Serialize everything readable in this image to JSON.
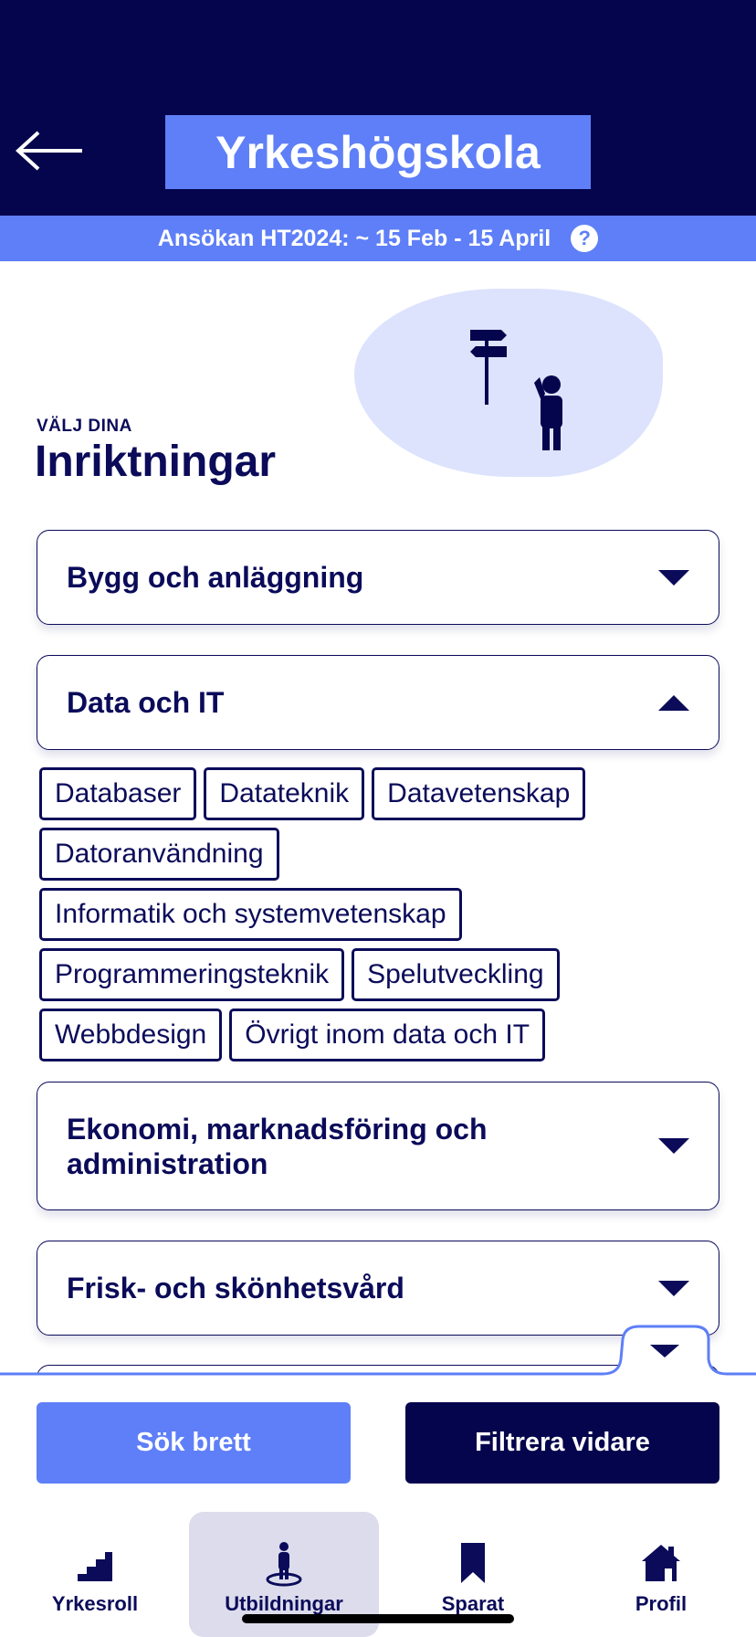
{
  "header": {
    "title": "Yrkeshögskola",
    "back_icon": "arrow-left-icon"
  },
  "info_bar": {
    "text": "Ansökan HT2024: ~ 15 Feb - 15 April",
    "help_icon": "question-circle-icon"
  },
  "intro": {
    "sub_heading": "VÄLJ DINA",
    "heading": "Inriktningar",
    "illustration": "signpost-person-illustration"
  },
  "categories": [
    {
      "label": "Bygg och anläggning",
      "expanded": false
    },
    {
      "label": "Data och IT",
      "expanded": true
    },
    {
      "label": "Ekonomi, marknadsföring och administration",
      "expanded": false
    },
    {
      "label": "Frisk- och skönhetsvård",
      "expanded": false
    }
  ],
  "chips": [
    [
      "Databaser",
      "Datateknik",
      "Datavetenskap"
    ],
    [
      "Datoranvändning"
    ],
    [
      "Informatik och systemvetenskap"
    ],
    [
      "Programmeringsteknik",
      "Spelutveckling"
    ],
    [
      "Webbdesign",
      "Övrigt inom data och IT"
    ]
  ],
  "actions": {
    "search_broad": "Sök brett",
    "filter_more": "Filtrera vidare"
  },
  "tabs": [
    {
      "label": "Yrkesroll",
      "icon": "stairs-icon",
      "active": false
    },
    {
      "label": "Utbildningar",
      "icon": "person-pin-icon",
      "active": true
    },
    {
      "label": "Sparat",
      "icon": "bookmark-icon",
      "active": false
    },
    {
      "label": "Profil",
      "icon": "home-icon",
      "active": false
    }
  ],
  "colors": {
    "navy": "#05054d",
    "accent": "#5e7ff7",
    "text": "#0b0b5a",
    "blob": "#dde3fd",
    "active_tab": "#dcdcec"
  }
}
